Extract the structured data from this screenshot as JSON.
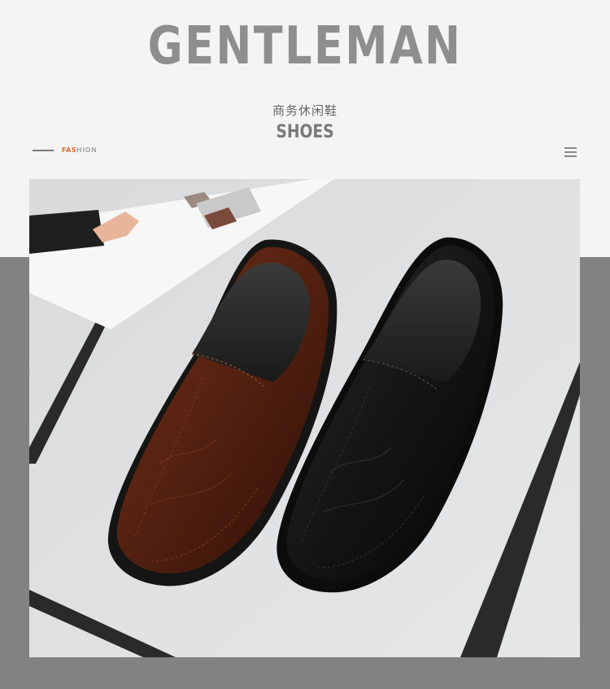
{
  "header": {
    "title": "GENTLEMAN",
    "subtitle_cn": "商务休闲鞋",
    "subtitle_en": "SHOES"
  },
  "tag": {
    "accent_part": "FAS",
    "rest_part": "HION"
  },
  "colors": {
    "accent": "#e8642c",
    "title_gray": "#8e8e8e",
    "panel_gray": "#828282",
    "background": "#f4f4f4"
  },
  "icons": {
    "menu": "hamburger-menu-icon"
  },
  "photo": {
    "subject": "brown-and-black-leather-loafers"
  }
}
